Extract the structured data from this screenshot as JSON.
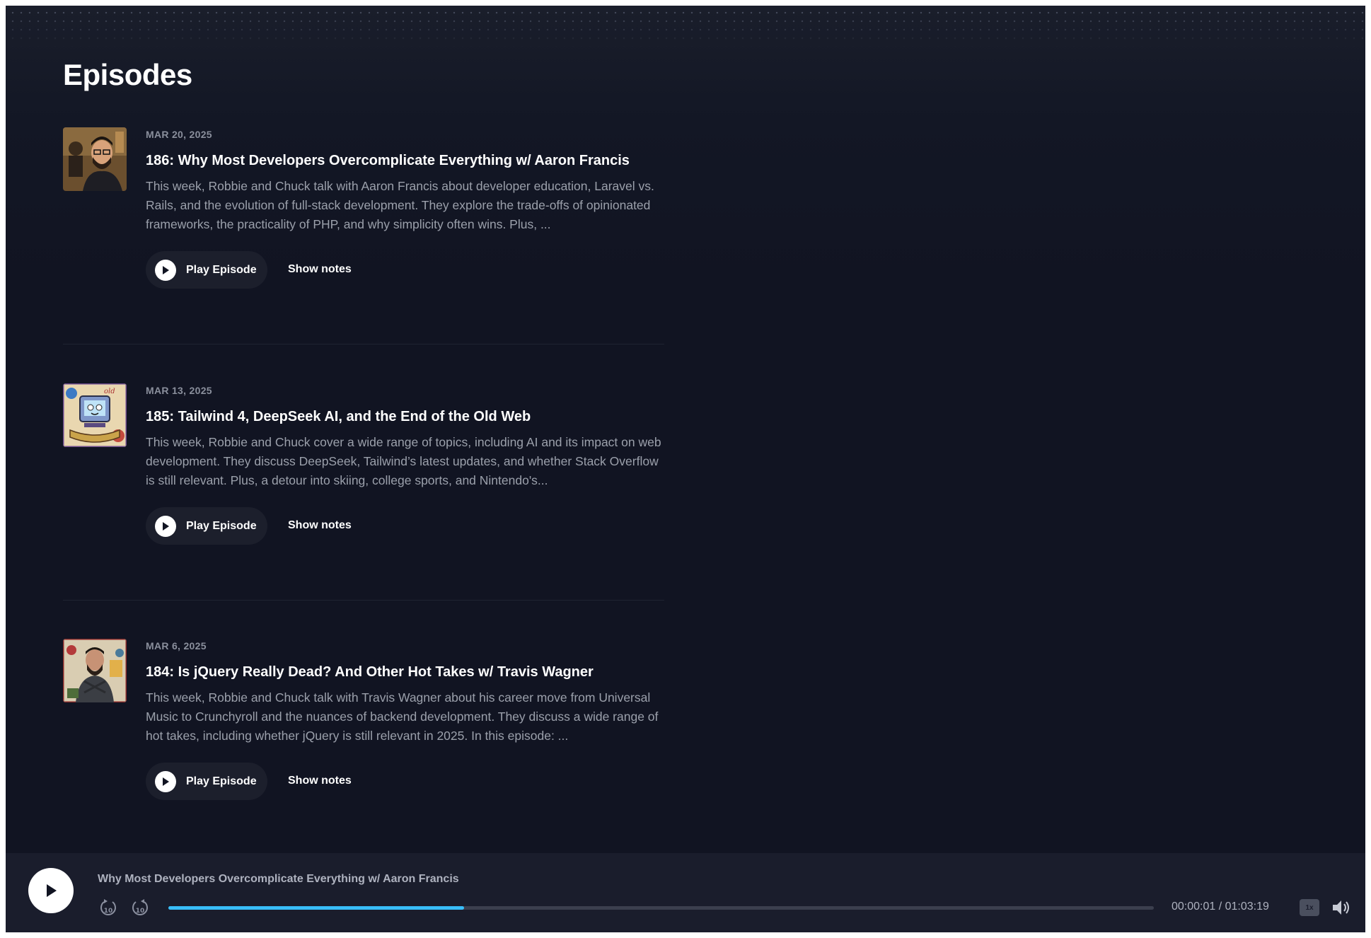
{
  "page": {
    "title": "Episodes"
  },
  "episodes": [
    {
      "date": "MAR 20, 2025",
      "title": "186: Why Most Developers Overcomplicate Everything w/ Aaron Francis",
      "description": "This week, Robbie and Chuck talk with Aaron Francis about developer education, Laravel vs. Rails, and the evolution of full-stack development. They explore the trade-offs of opinionated frameworks, the practicality of PHP, and why simplicity often wins. Plus, ...",
      "play_label": "Play Episode",
      "notes_label": "Show notes",
      "artwork": "host-portrait-icon"
    },
    {
      "date": "MAR 13, 2025",
      "title": "185: Tailwind 4, DeepSeek AI, and the End of the Old Web",
      "description": "This week, Robbie and Chuck cover a wide range of topics, including AI and its impact on web development. They discuss DeepSeek, Tailwind’s latest updates, and whether Stack Overflow is still relevant. Plus, a detour into skiing, college sports, and Nintendo's...",
      "play_label": "Play Episode",
      "notes_label": "Show notes",
      "artwork": "old-web-computer-icon"
    },
    {
      "date": "MAR 6, 2025",
      "title": "184: Is jQuery Really Dead? And Other Hot Takes w/ Travis Wagner",
      "description": "This week, Robbie and Chuck talk with Travis Wagner about his career move from Universal Music to Crunchyroll and the nuances of backend development. They discuss a wide range of hot takes, including whether jQuery is still relevant in 2025. In this episode: ...",
      "play_label": "Play Episode",
      "notes_label": "Show notes",
      "artwork": "guest-portrait-icon"
    }
  ],
  "player": {
    "now_playing": "Why Most Developers Overcomplicate Everything w/ Aaron Francis",
    "rewind_label": "10",
    "forward_label": "10",
    "progress_fraction": 0.3,
    "time": "00:00:01 / 01:03:19",
    "speed": "1x",
    "accent_color": "#38bdf8"
  }
}
